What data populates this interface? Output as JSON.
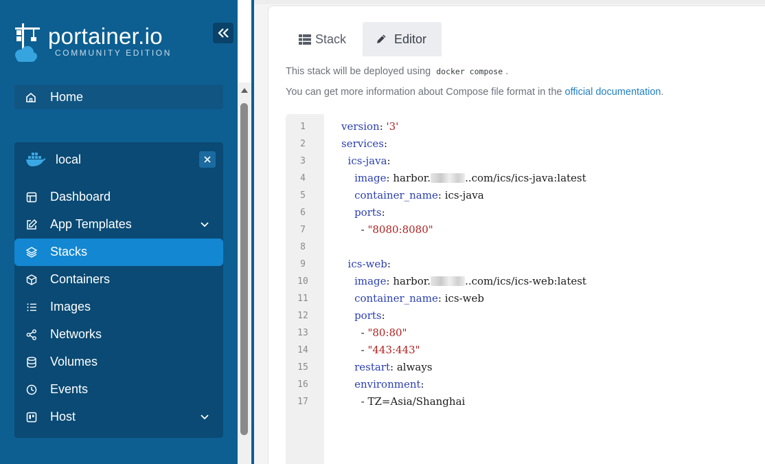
{
  "brand": {
    "name": "portainer.io",
    "edition": "COMMUNITY EDITION"
  },
  "sidebar": {
    "home_label": "Home",
    "environment": {
      "name": "local",
      "items": [
        {
          "label": "Dashboard",
          "icon": "dashboard-icon"
        },
        {
          "label": "App Templates",
          "icon": "edit-icon",
          "expandable": true
        },
        {
          "label": "Stacks",
          "icon": "layers-icon",
          "active": true
        },
        {
          "label": "Containers",
          "icon": "box-icon"
        },
        {
          "label": "Images",
          "icon": "list-icon"
        },
        {
          "label": "Networks",
          "icon": "share-icon"
        },
        {
          "label": "Volumes",
          "icon": "database-icon"
        },
        {
          "label": "Events",
          "icon": "clock-icon"
        },
        {
          "label": "Host",
          "icon": "host-icon",
          "expandable": true
        }
      ]
    }
  },
  "tabs": {
    "stack": "Stack",
    "editor": "Editor",
    "active": "editor"
  },
  "info": {
    "line1_prefix": "This stack will be deployed using",
    "line1_code": "docker compose",
    "line1_suffix": ".",
    "line2_prefix": "You can get more information about Compose file format in the",
    "line2_link": "official documentation",
    "line2_suffix": "."
  },
  "code": {
    "line_numbers": [
      "1",
      "2",
      "3",
      "4",
      "5",
      "6",
      "7",
      "8",
      "9",
      "10",
      "11",
      "12",
      "13",
      "14",
      "15",
      "16",
      "17"
    ],
    "lines": [
      {
        "indent": "",
        "key": "version",
        "sep": ": ",
        "str": "'3'"
      },
      {
        "indent": "",
        "key": "services",
        "sep": ":"
      },
      {
        "indent": "  ",
        "key": "ics-java",
        "sep": ":"
      },
      {
        "indent": "    ",
        "key": "image",
        "sep": ": ",
        "val_pre": "harbor.",
        "redacted": true,
        "val_post": "..com/ics/ics-java:latest"
      },
      {
        "indent": "    ",
        "key": "container_name",
        "sep": ": ",
        "val": "ics-java"
      },
      {
        "indent": "    ",
        "key": "ports",
        "sep": ":"
      },
      {
        "indent": "      ",
        "plain": "- ",
        "str": "\"8080:8080\""
      },
      {
        "indent": ""
      },
      {
        "indent": "  ",
        "key": "ics-web",
        "sep": ":"
      },
      {
        "indent": "    ",
        "key": "image",
        "sep": ": ",
        "val_pre": "harbor.",
        "redacted": true,
        "val_post": "..com/ics/ics-web:latest"
      },
      {
        "indent": "    ",
        "key": "container_name",
        "sep": ": ",
        "val": "ics-web"
      },
      {
        "indent": "    ",
        "key": "ports",
        "sep": ":"
      },
      {
        "indent": "      ",
        "plain": "- ",
        "str": "\"80:80\""
      },
      {
        "indent": "      ",
        "plain": "- ",
        "str": "\"443:443\""
      },
      {
        "indent": "    ",
        "key": "restart",
        "sep": ": ",
        "val": "always"
      },
      {
        "indent": "    ",
        "key": "environment",
        "sep": ":"
      },
      {
        "indent": "      ",
        "plain": "- TZ=Asia/Shanghai"
      }
    ]
  },
  "colors": {
    "sidebar_bg": "#0d5f92",
    "active_item": "#1387d2",
    "yaml_key": "#2a3fb0",
    "yaml_string": "#b11f1f",
    "link": "#1f7fc2"
  }
}
